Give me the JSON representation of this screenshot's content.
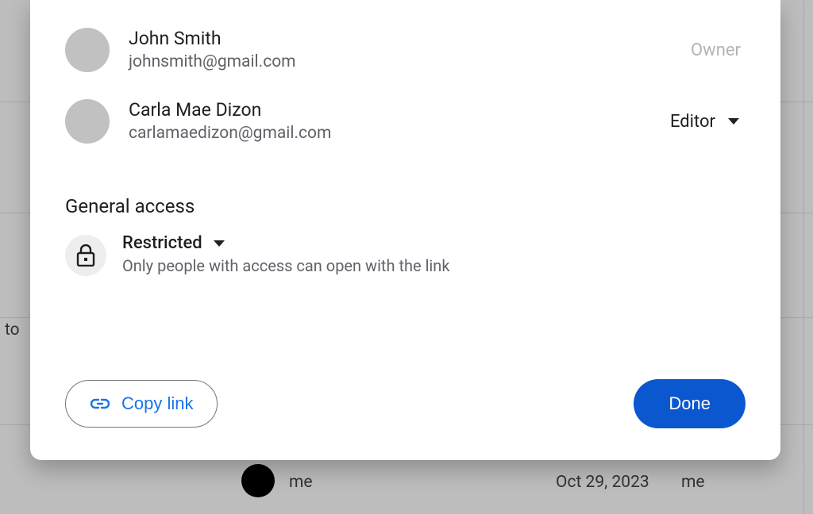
{
  "people": [
    {
      "name": "John Smith",
      "email": "johnsmith@gmail.com",
      "role": "Owner"
    },
    {
      "name": "Carla Mae Dizon",
      "email": "carlamaedizon@gmail.com",
      "role": "Editor"
    }
  ],
  "general_access": {
    "section_title": "General access",
    "mode": "Restricted",
    "description": "Only people with access can open with the link"
  },
  "footer": {
    "copy_link": "Copy link",
    "done": "Done"
  },
  "background": {
    "to": "to",
    "me": "me",
    "date": "Oct 29, 2023",
    "me2": "me"
  }
}
